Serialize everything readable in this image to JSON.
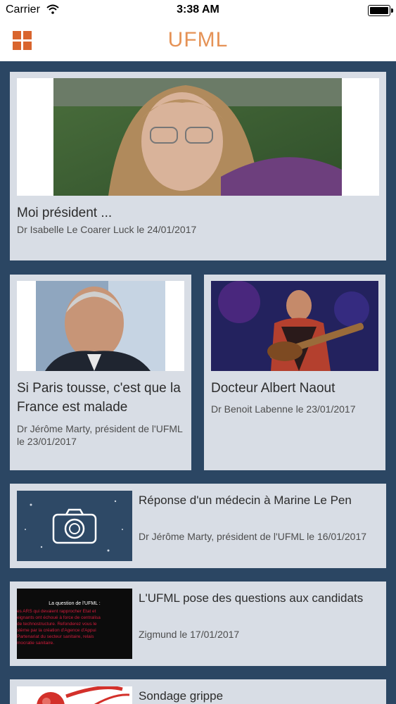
{
  "status_bar": {
    "carrier": "Carrier",
    "time": "3:38 AM"
  },
  "header": {
    "title": "UFML",
    "brand_color": "#e59256",
    "menu_icon": "grid-menu-icon"
  },
  "articles": [
    {
      "title": "Moi président ...",
      "meta": "Dr Isabelle Le Coarer Luck le 24/01/2017",
      "image": "portrait-photo"
    },
    {
      "title": "Si Paris tousse,  c'est que la France est malade",
      "meta": "Dr Jérôme Marty, président de l'UFML le 23/01/2017",
      "image": "portrait-photo"
    },
    {
      "title": "Docteur Albert Naout",
      "meta": "Dr Benoit Labenne le 23/01/2017",
      "image": "guitarist-photo"
    },
    {
      "title": "Réponse  d'un médecin à Marine Le Pen",
      "meta": "Dr Jérôme Marty, président de l'UFML le 16/01/2017",
      "image": "camera-placeholder-icon"
    },
    {
      "title": "L'UFML pose des  questions  aux candidats",
      "meta": "Zigmund le 17/01/2017",
      "image": "text-slide-image",
      "image_text": {
        "heading": "La question de l'UFML :",
        "lines": [
          "es ARS qui devaient rapprocher Etat et",
          "eignants ont échoué à force de centralisa",
          "de technostructure. Refonderez vous le",
          "stème par la création d'Agence d'Appui",
          "Partenariat du secteur sanitaire, relais",
          "mocratie sanitaire."
        ]
      }
    },
    {
      "title": "Sondage  grippe",
      "meta": "",
      "image": "sondage-logo"
    }
  ]
}
